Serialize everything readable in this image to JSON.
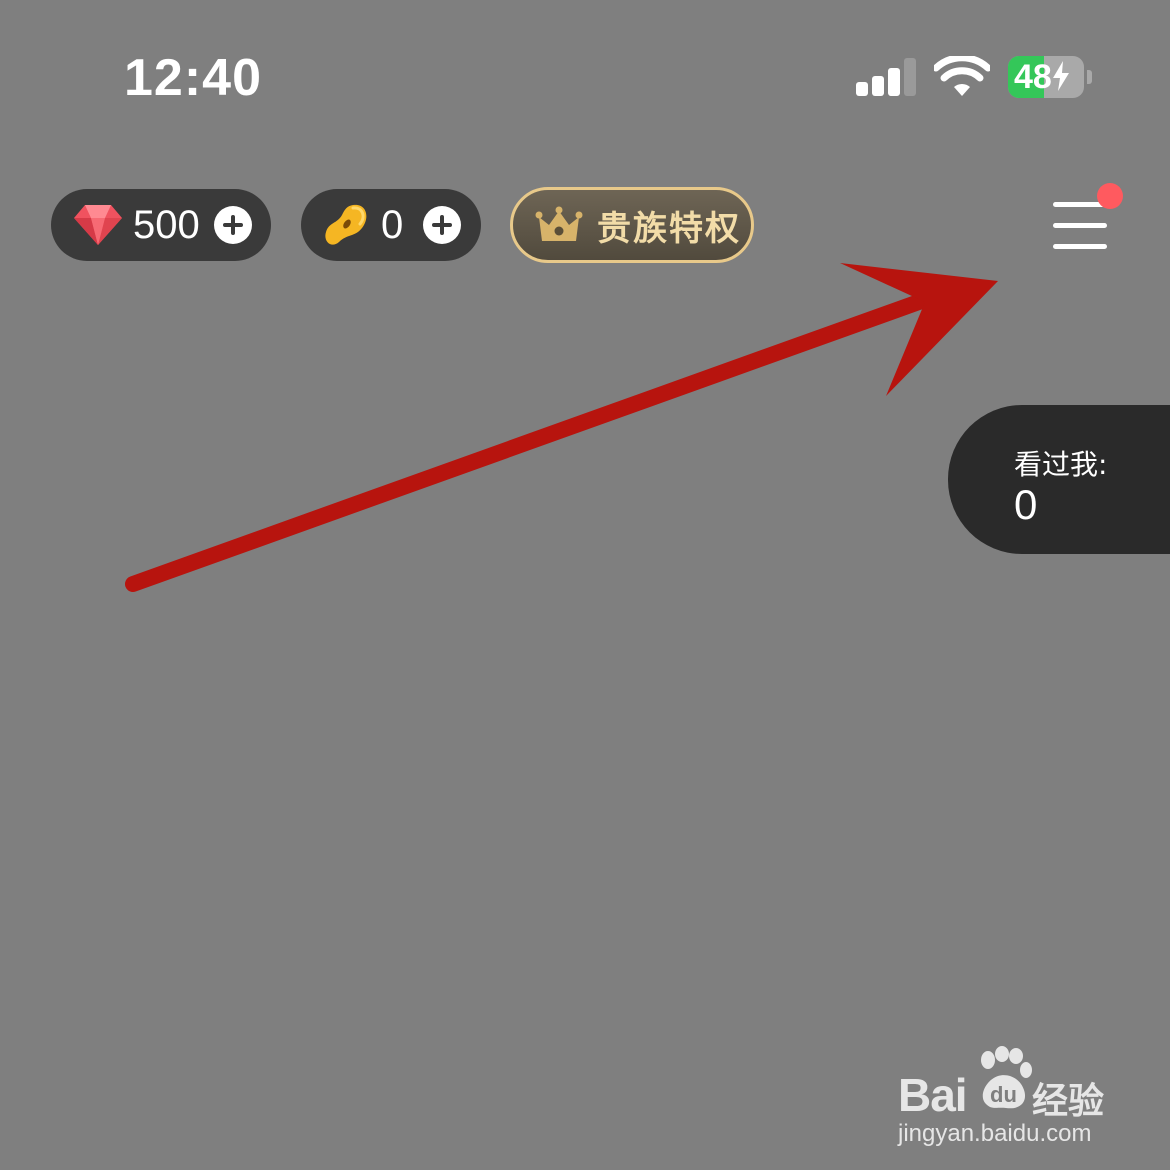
{
  "status_bar": {
    "time": "12:40",
    "battery_level": "48",
    "battery_percent": 48,
    "icons": [
      "cellular-signal-icon",
      "wifi-icon",
      "battery-charging-icon"
    ]
  },
  "wallet": {
    "diamonds": "500",
    "beans": "0"
  },
  "noble_privilege": {
    "label": "贵族特权"
  },
  "menu": {
    "has_notification": true,
    "notification_color": "#ff5a5f"
  },
  "viewed_me": {
    "label": "看过我:",
    "count": "0"
  },
  "annotation": {
    "arrow_color": "#b7140e"
  },
  "watermark": {
    "brand": "Bai",
    "brand_suffix": "经验",
    "url": "jingyan.baidu.com"
  },
  "colors": {
    "background": "#7f7f7f",
    "pill": "#3a3a3a",
    "gold": "#e8c98a"
  }
}
